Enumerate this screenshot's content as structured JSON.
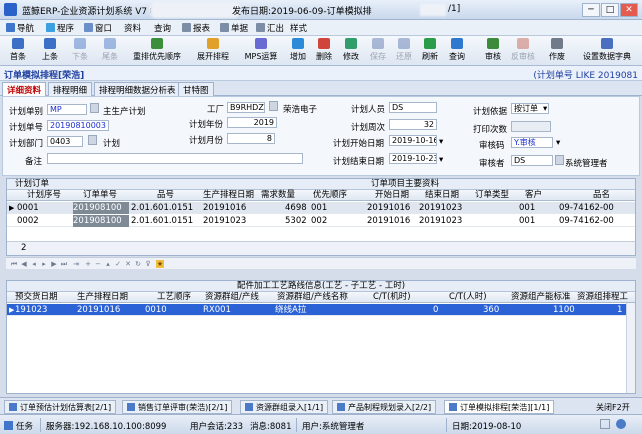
{
  "window": {
    "title_left": "蓝鲸ERP-企业资源计划系统 V7 帐套",
    "title_right": "发布日期:2019-06-09-订单模拟排",
    "title_suffix": "/1]",
    "min": "─",
    "max": "□",
    "close": "✕"
  },
  "menu": [
    "导航",
    "程序",
    "窗口",
    "资料",
    "查询",
    "报表",
    "单据",
    "汇出",
    "样式"
  ],
  "toolbar": {
    "first": "首条",
    "prev": "上条",
    "next": "下条",
    "last": "尾条",
    "reorder": "重排优先顺序",
    "expand": "展开排程",
    "mps": "MPS运算",
    "add": "增加",
    "delete": "删除",
    "edit": "修改",
    "save": "保存",
    "undo": "还原",
    "refresh": "刷新",
    "query": "查询",
    "audit": "审核",
    "unaudit": "反审核",
    "void": "作废",
    "dict": "设置数据字典"
  },
  "header": {
    "title": "订单模拟排程[荣浩]",
    "filter": "(计划单号 LIKE 2019081"
  },
  "tabs": [
    "详细资料",
    "排程明细",
    "排程明细数据分析表",
    "甘特图"
  ],
  "form": {
    "plan_type_label": "计划单别",
    "plan_type_code": "MP",
    "plan_type_name": "主生产计划",
    "plan_no_label": "计划单号",
    "plan_no": "20190810003",
    "plan_year_label": "计划年份",
    "plan_year": "2019",
    "plan_month_label": "计划月份",
    "plan_month": "8",
    "dept_label": "计划部门",
    "dept_code": "0403",
    "dept_name": "计划",
    "factory_label": "工厂",
    "factory_code": "B9RHDZ",
    "factory_name": "荣浩电子",
    "planner_label": "计划人员",
    "planner": "DS",
    "week_label": "计划周次",
    "week": "32",
    "start_label": "计划开始日期",
    "start_date": "2019-10-16",
    "end_label": "计划结束日期",
    "end_date": "2019-10-23",
    "basis_label": "计划依据",
    "basis": "按订单",
    "print_label": "打印次数",
    "print_count": "",
    "audit_label": "审核码",
    "audit_code": "Y.审核",
    "auditor_label": "审核者",
    "auditor_code": "DS",
    "auditor_name": "系统管理者",
    "remark_label": "备注",
    "remark": ""
  },
  "orders": {
    "section_title": "计划订单",
    "right_section_title": "订单项目主要资料",
    "columns": [
      "计划序号",
      "订单单号",
      "品号",
      "生产排程日期",
      "需求数量",
      "优先顺序",
      "开始日期",
      "结束日期",
      "订单类型",
      "客户",
      "品名"
    ],
    "rows": [
      {
        "seq": "0001",
        "order_no": "201908100",
        "part_no": "2.01.601.0151",
        "sched_date": "20191016",
        "qty": "4698",
        "priority": "001",
        "start": "20191016",
        "end": "20191023",
        "type": "",
        "customer": "001",
        "name": "09-74162-00"
      },
      {
        "seq": "0002",
        "order_no": "201908100",
        "part_no": "2.01.601.0151",
        "sched_date": "20191023",
        "qty": "5302",
        "priority": "002",
        "start": "20191016",
        "end": "20191023",
        "type": "",
        "customer": "001",
        "name": "09-74162-00"
      }
    ],
    "count": "2"
  },
  "process": {
    "section_title": "配件加工工艺路线信息(工艺 - 子工艺 - 工时)",
    "columns": [
      "预交货日期",
      "生产排程日期",
      "工艺顺序",
      "资源群组/产线",
      "资源群组/产线名称",
      "C/T(机时)",
      "C/T(人时)",
      "资源组产能标准",
      "资源组排程工"
    ],
    "rows": [
      {
        "due": "191023",
        "sched": "20191016",
        "order": "0010",
        "group": "RX001",
        "group_name": "绕线A拉",
        "ct_machine": "0",
        "ct_man": "360",
        "capacity": "1100",
        "sched_work": "1"
      }
    ]
  },
  "bottom_tabs": [
    "订单预估计划估算表[2/1]",
    "销售订单评审(荣浩)[2/1]",
    "资源群组录入[1/1]",
    "产品制程规划录入[2/2]",
    "订单模拟排程[荣浩][1/1]"
  ],
  "bottom_close": "关闭F2开",
  "status": {
    "task": "任务",
    "server": "服务器:192.168.10.100:8099",
    "users": "用户会话:233",
    "msg": "消息:8081",
    "user": "用户:系统管理者",
    "date": "日期:2019-08-10"
  }
}
